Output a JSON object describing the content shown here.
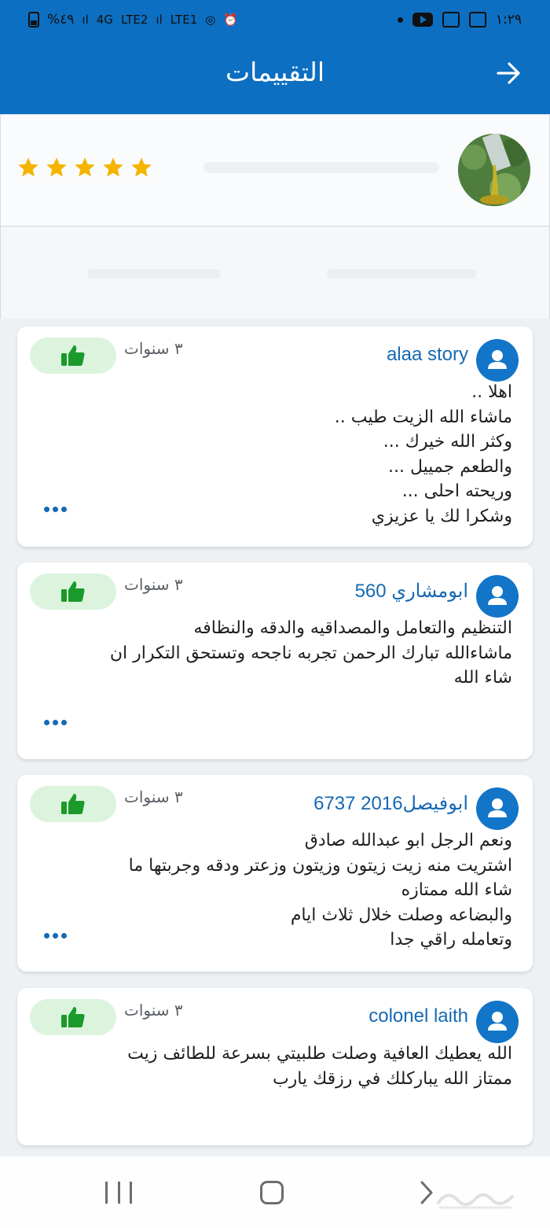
{
  "status_bar": {
    "battery_text": "%٤٩",
    "net1": "4G",
    "net2": "LTE2",
    "net3": "LTE1",
    "time": "١:٢٩"
  },
  "header": {
    "title": "التقييمات"
  },
  "product": {
    "rating": 5
  },
  "reviews": [
    {
      "name": "alaa story",
      "age": "٣ سنوات",
      "text": "اهلا ..\nماشاء الله الزيت طيب ..\nوكثر الله خيرك ...\nوالطعم جمييل ...\nوريحته احلى ...\nوشكرا لك يا عزيزي"
    },
    {
      "name": "ابومشاري 560",
      "age": "٣ سنوات",
      "text": "التنظيم والتعامل والمصداقيه والدقه والنظافه\nماشاءالله تبارك الرحمن تجربه ناجحه وتستحق التكرار ان\nشاء الله"
    },
    {
      "name": "ابوفيصل2016 6737",
      "age": "٣ سنوات",
      "text": "ونعم الرجل ابو عبدالله صادق\nاشتريت منه زيت زيتون وزيتون وزعتر ودقه وجربتها ما\nشاء الله ممتازه\nوالبضاعه وصلت خلال ثلاث ايام\nوتعامله راقي جدا"
    },
    {
      "name": "colonel laith",
      "age": "٣ سنوات",
      "text": "الله يعطيك العافية وصلت طلبيتي بسرعة للطائف زيت\nممتاز الله يباركلك في رزقك يارب"
    }
  ],
  "colors": {
    "primary": "#0d6fc1",
    "star": "#f5b400",
    "like_bg": "#dcf4de",
    "like_icon": "#1a9a2a",
    "link": "#1669b3"
  }
}
